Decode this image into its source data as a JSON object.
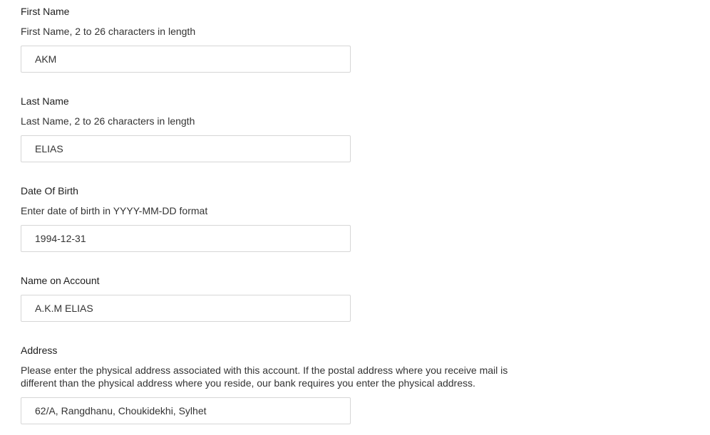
{
  "fields": {
    "first_name": {
      "label": "First Name",
      "helper": "First Name, 2 to 26 characters in length",
      "value": "AKM"
    },
    "last_name": {
      "label": "Last Name",
      "helper": "Last Name, 2 to 26 characters in length",
      "value": "ELIAS"
    },
    "date_of_birth": {
      "label": "Date Of Birth",
      "helper": "Enter date of birth in YYYY-MM-DD format",
      "value": "1994-12-31"
    },
    "name_on_account": {
      "label": "Name on Account",
      "value": "A.K.M ELIAS"
    },
    "address": {
      "label": "Address",
      "helper": "Please enter the physical address associated with this account. If the postal address where you receive mail is different than the physical address where you reside, our bank requires you enter the physical address.",
      "value": "62/A, Rangdhanu, Choukidekhi, Sylhet"
    }
  }
}
